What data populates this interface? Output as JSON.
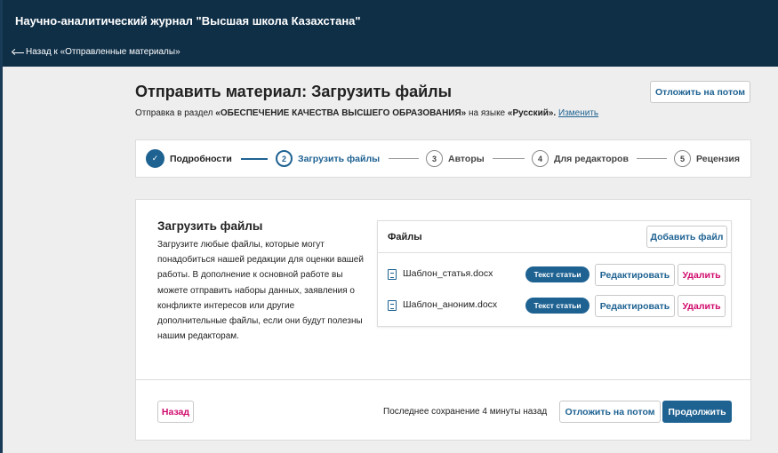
{
  "header": {
    "journal_title": "Научно-аналитический журнал \"Высшая школа Казахстана\"",
    "back_link": "Назад к «Отправленные материалы»"
  },
  "page": {
    "title": "Отправить материал: Загрузить файлы",
    "section_prefix": "Отправка в раздел",
    "section_name": "«ОБЕСПЕЧЕНИЕ КАЧЕСТВА ВЫСШЕГО ОБРАЗОВАНИЯ»",
    "language_prefix": "на языке",
    "language": "«Русский».",
    "change_link": "Изменить",
    "save_later": "Отложить на потом"
  },
  "steps": [
    {
      "num": "✓",
      "label": "Подробности",
      "state": "done"
    },
    {
      "num": "2",
      "label": "Загрузить файлы",
      "state": "current"
    },
    {
      "num": "3",
      "label": "Авторы",
      "state": "pending"
    },
    {
      "num": "4",
      "label": "Для редакторов",
      "state": "pending"
    },
    {
      "num": "5",
      "label": "Рецензия",
      "state": "pending"
    }
  ],
  "upload": {
    "title": "Загрузить файлы",
    "description": "Загрузите любые файлы, которые могут понадобиться нашей редакции для оценки вашей работы. В дополнение к основной работе вы можете отправить наборы данных, заявления о конфликте интересов или другие дополнительные файлы, если они будут полезны нашим редакторам."
  },
  "files": {
    "label": "Файлы",
    "add_file": "Добавить файл",
    "items": [
      {
        "name": "Шаблон_статья.docx",
        "tag": "Текст статьи",
        "edit": "Редактировать",
        "delete": "Удалить"
      },
      {
        "name": "Шаблон_аноним.docx",
        "tag": "Текст статьи",
        "edit": "Редактировать",
        "delete": "Удалить"
      }
    ]
  },
  "footer": {
    "back": "Назад",
    "last_save": "Последнее сохранение 4 минуты назад",
    "save_later": "Отложить на потом",
    "continue": "Продолжить"
  },
  "colors": {
    "header_bg": "#0f2f47",
    "primary": "#1e6292",
    "danger": "#d00a6c"
  }
}
